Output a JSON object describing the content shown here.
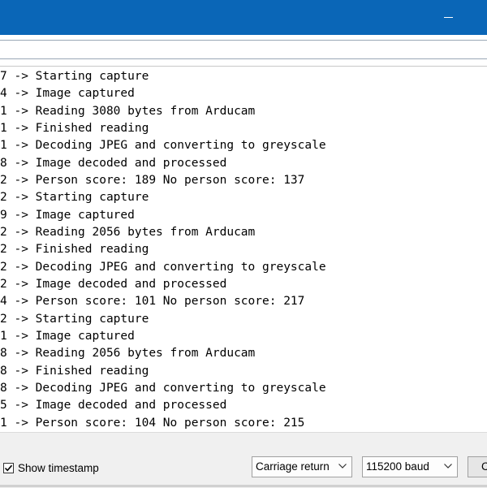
{
  "window": {
    "titlebar_color": "#0a66b7",
    "minimize_icon": "minimize-icon"
  },
  "send_input": {
    "value": ""
  },
  "output_lines": [
    "7 -> Starting capture",
    "4 -> Image captured",
    "1 -> Reading 3080 bytes from Arducam",
    "1 -> Finished reading",
    "1 -> Decoding JPEG and converting to greyscale",
    "8 -> Image decoded and processed",
    "2 -> Person score: 189 No person score: 137",
    "2 -> Starting capture",
    "9 -> Image captured",
    "2 -> Reading 2056 bytes from Arducam",
    "2 -> Finished reading",
    "2 -> Decoding JPEG and converting to greyscale",
    "2 -> Image decoded and processed",
    "4 -> Person score: 101 No person score: 217",
    "2 -> Starting capture",
    "1 -> Image captured",
    "8 -> Reading 2056 bytes from Arducam",
    "8 -> Finished reading",
    "8 -> Decoding JPEG and converting to greyscale",
    "5 -> Image decoded and processed",
    "1 -> Person score: 104 No person score: 215"
  ],
  "statusbar": {
    "show_timestamp_label": "Show timestamp",
    "show_timestamp_checked": true,
    "line_ending": "Carriage return",
    "baud_rate": "115200 baud",
    "clear_button_label": "C"
  }
}
